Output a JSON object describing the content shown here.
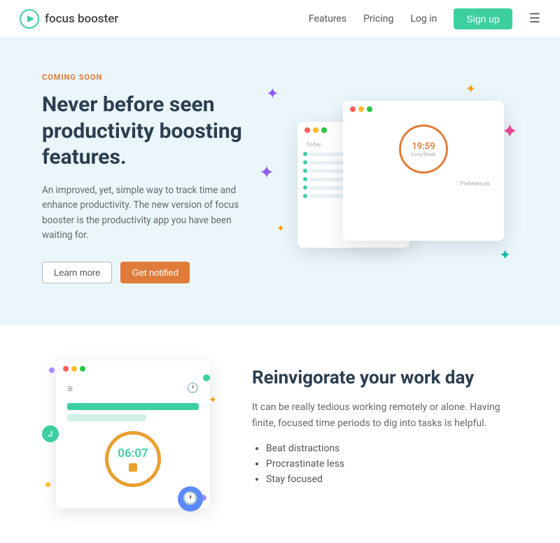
{
  "nav": {
    "brand": "focus booster",
    "links": [
      "Features",
      "Pricing",
      "Log in"
    ],
    "signup": "Sign up"
  },
  "hero": {
    "badge": "COMING SOON",
    "title": "Never before seen productivity boosting features.",
    "desc": "An improved, yet, simple way to track time and enhance productivity. The new version of focus booster is the productivity app you have been waiting for.",
    "btn_learn": "Learn more",
    "btn_notify": "Get notified",
    "timer_display": "19:59",
    "timer_label": "Long Break"
  },
  "section2": {
    "title": "Reinvigorate your work day",
    "desc": "It can be really tedious working remotely or alone. Having finite, focused time periods to dig into tasks is helpful.",
    "bullets": [
      "Beat distractions",
      "Procrastinate less",
      "Stay focused"
    ],
    "timer2_display": "06:07",
    "badge_letter": "J"
  }
}
